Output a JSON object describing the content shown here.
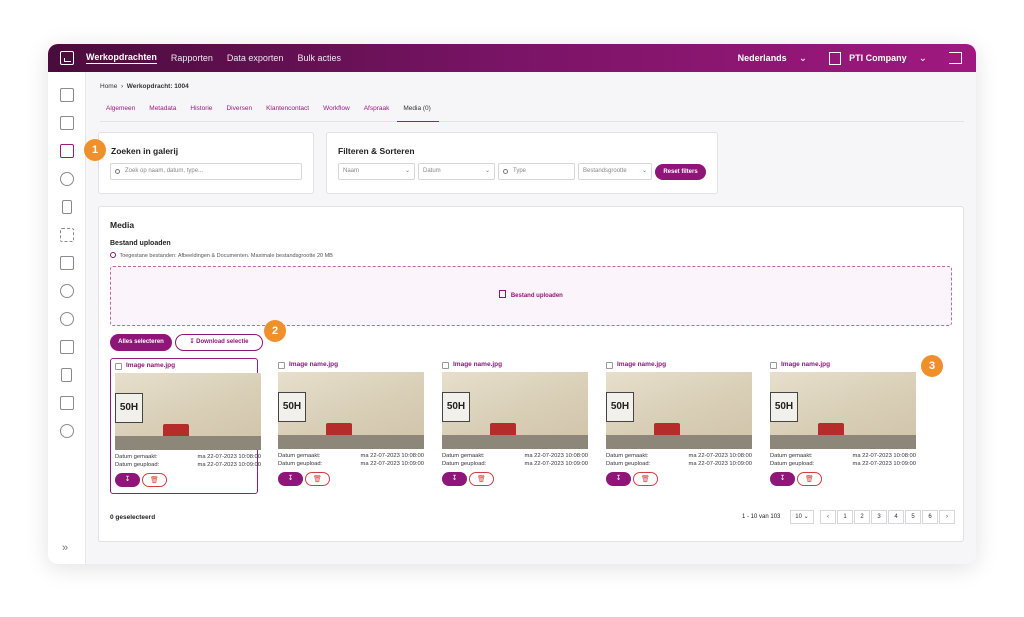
{
  "topbar": {
    "nav": [
      "Werkopdrachten",
      "Rapporten",
      "Data exporten",
      "Bulk acties"
    ],
    "language": "Nederlands",
    "company": "PTI Company"
  },
  "breadcrumb": {
    "home": "Home",
    "current": "Werkopdracht: 1004"
  },
  "tabs": [
    "Algemeen",
    "Metadata",
    "Historie",
    "Diversen",
    "Klantencontact",
    "Workflow",
    "Afspraak",
    "Media (0)"
  ],
  "search": {
    "title": "Zoeken in galerij",
    "placeholder": "Zoek op naam, datum, type..."
  },
  "filters": {
    "title": "Filteren & Sorteren",
    "naam": "Naam",
    "datum": "Datum",
    "type_placeholder": "Type",
    "size": "Bestandsgrootte",
    "reset": "Reset filters"
  },
  "media": {
    "title": "Media",
    "upload_title": "Bestand uploaden",
    "upload_hint": "Toegestane bestanden: Afbeeldingen & Documenten. Maximale bestandsgrootte 20 MB",
    "upload_button": "Bestand uploaden",
    "select_all": "Alles selecteren",
    "download_selection": "Download selectie",
    "created_label": "Datum gemaakt:",
    "uploaded_label": "Datum geupload:",
    "items": [
      {
        "name": "Image name.jpg",
        "created": "ma 22-07-2023 10:08:00",
        "uploaded": "ma 22-07-2023 10:09:00"
      },
      {
        "name": "Image name.jpg",
        "created": "ma 22-07-2023 10:08:00",
        "uploaded": "ma 22-07-2023 10:09:00"
      },
      {
        "name": "Image name.jpg",
        "created": "ma 22-07-2023 10:08:00",
        "uploaded": "ma 22-07-2023 10:09:00"
      },
      {
        "name": "Image name.jpg",
        "created": "ma 22-07-2023 10:08:00",
        "uploaded": "ma 22-07-2023 10:09:00"
      },
      {
        "name": "Image name.jpg",
        "created": "ma 22-07-2023 10:08:00",
        "uploaded": "ma 22-07-2023 10:09:00"
      }
    ],
    "selected_count": "0 geselecteerd",
    "range": "1 - 10 van 103",
    "per_page": "10",
    "pages": [
      "1",
      "2",
      "3",
      "4",
      "5",
      "6"
    ]
  },
  "badges": [
    "1",
    "2",
    "3"
  ],
  "colors": {
    "brand": "#8f1578",
    "badge": "#f0902a"
  }
}
